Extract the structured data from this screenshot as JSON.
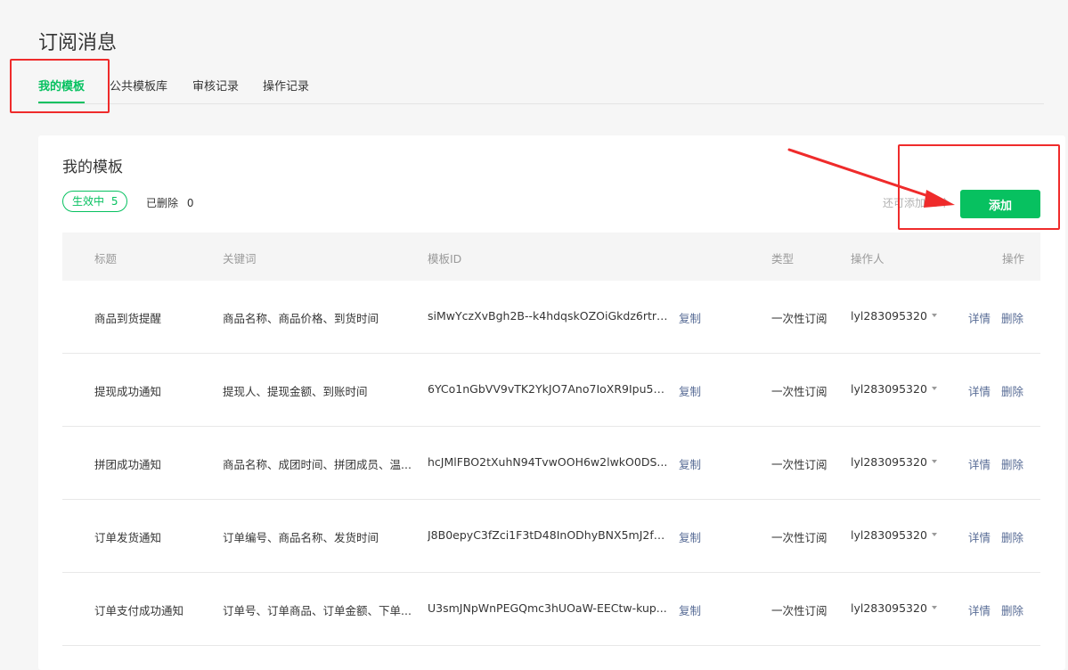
{
  "page": {
    "title": "订阅消息"
  },
  "tabs": [
    {
      "label": "我的模板",
      "active": true
    },
    {
      "label": "公共模板库",
      "active": false
    },
    {
      "label": "审核记录",
      "active": false
    },
    {
      "label": "操作记录",
      "active": false
    }
  ],
  "card": {
    "title": "我的模板",
    "active_label": "生效中",
    "active_count": "5",
    "deleted_label": "已删除",
    "deleted_count": "0",
    "remain_text": "还可添加15个",
    "add_button": "添加"
  },
  "table": {
    "headers": [
      "标题",
      "关键词",
      "模板ID",
      "类型",
      "操作人",
      "操作"
    ],
    "rows": [
      {
        "title": "商品到货提醒",
        "keywords": "商品名称、商品价格、到货时间",
        "template_id": "siMwYczXvBgh2B--k4hdqskOZOiGkdz6rtrL...",
        "copy": "复制",
        "type": "一次性订阅",
        "operator": "lyl283095320",
        "detail": "详情",
        "delete": "删除"
      },
      {
        "title": "提现成功通知",
        "keywords": "提现人、提现金额、到账时间",
        "template_id": "6YCo1nGbVV9vTK2YkJO7Ano7IoXR9Ipu5c...",
        "copy": "复制",
        "type": "一次性订阅",
        "operator": "lyl283095320",
        "detail": "详情",
        "delete": "删除"
      },
      {
        "title": "拼团成功通知",
        "keywords": "商品名称、成团时间、拼团成员、温...",
        "template_id": "hcJMlFBO2tXuhN94TvwOOH6w2lwkO0DS...",
        "copy": "复制",
        "type": "一次性订阅",
        "operator": "lyl283095320",
        "detail": "详情",
        "delete": "删除"
      },
      {
        "title": "订单发货通知",
        "keywords": "订单编号、商品名称、发货时间",
        "template_id": "J8B0epyC3fZci1F3tD48InODhyBNX5mJ2fL1...",
        "copy": "复制",
        "type": "一次性订阅",
        "operator": "lyl283095320",
        "detail": "详情",
        "delete": "删除"
      },
      {
        "title": "订单支付成功通知",
        "keywords": "订单号、订单商品、订单金额、下单...",
        "template_id": "U3smJNpWnPEGQmc3hUOaW-EECtw-kup...",
        "copy": "复制",
        "type": "一次性订阅",
        "operator": "lyl283095320",
        "detail": "详情",
        "delete": "删除"
      }
    ]
  },
  "annotation_color": "#ef2b2b",
  "accent_color": "#07c160",
  "link_color": "#576b95"
}
